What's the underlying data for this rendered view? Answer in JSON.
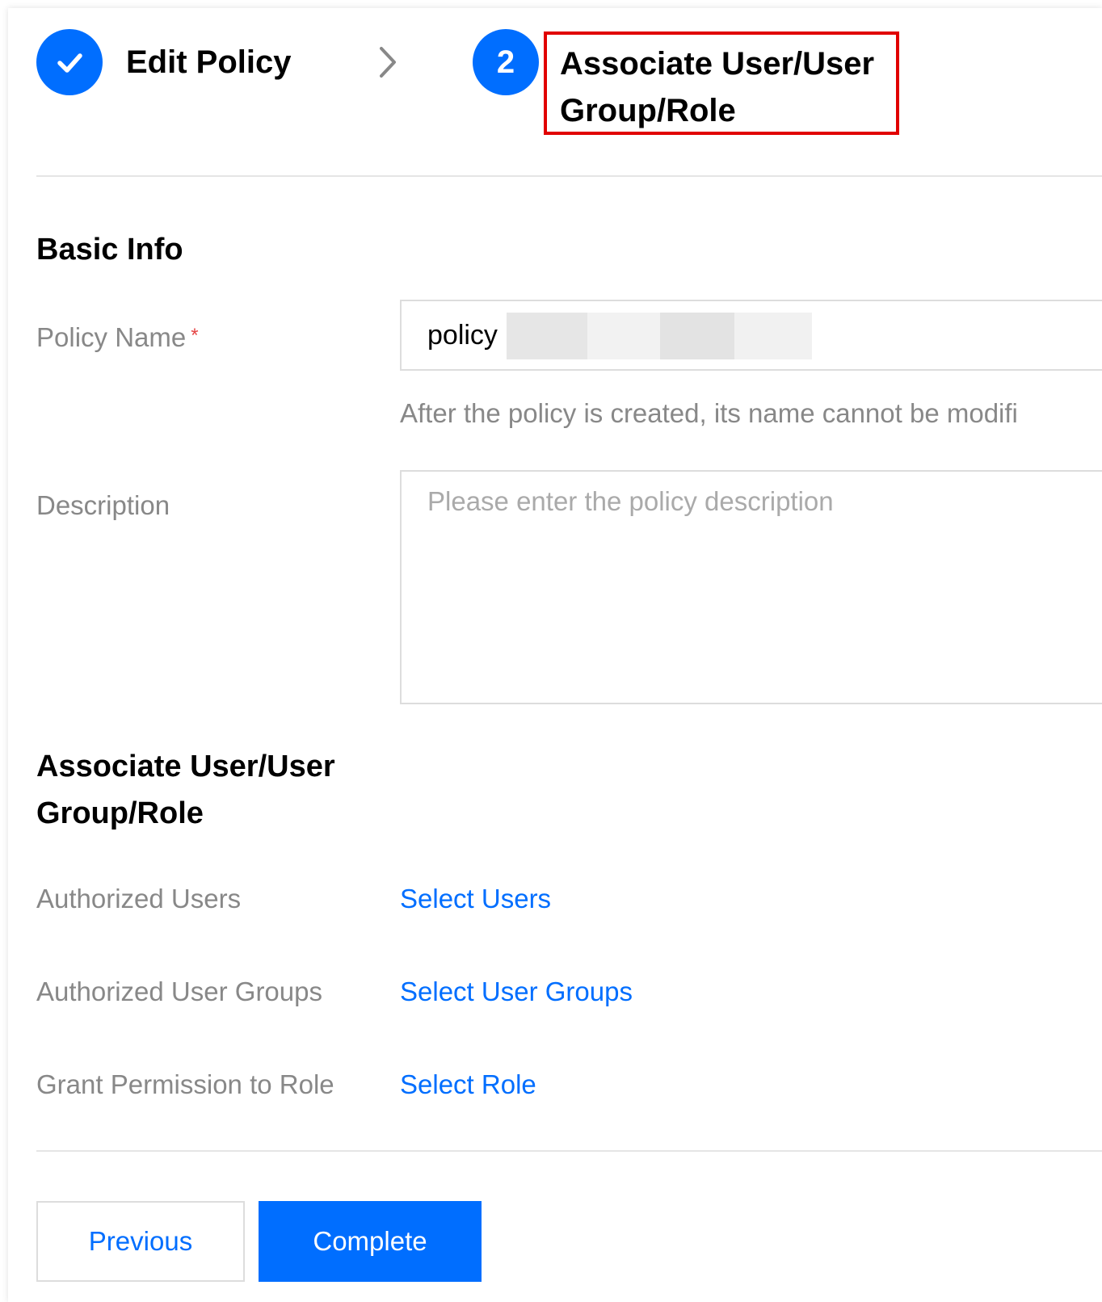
{
  "steps": {
    "step1_label": "Edit Policy",
    "step2_number": "2",
    "step2_label": "Associate User/User Group/Role"
  },
  "basic_info": {
    "title": "Basic Info",
    "policy_name_label": "Policy Name",
    "required_mark": "*",
    "policy_name_value": "policy",
    "policy_name_help": "After the policy is created, its name cannot be modifi",
    "description_label": "Description",
    "description_placeholder": "Please enter the policy description"
  },
  "associate": {
    "title": "Associate User/User Group/Role",
    "authorized_users_label": "Authorized Users",
    "select_users": "Select Users",
    "authorized_groups_label": "Authorized User Groups",
    "select_groups": "Select User Groups",
    "grant_role_label": "Grant Permission to Role",
    "select_role": "Select Role"
  },
  "buttons": {
    "previous": "Previous",
    "complete": "Complete"
  },
  "colors": {
    "primary": "#006eff",
    "highlight_border": "#e10000",
    "required": "#e54545"
  }
}
